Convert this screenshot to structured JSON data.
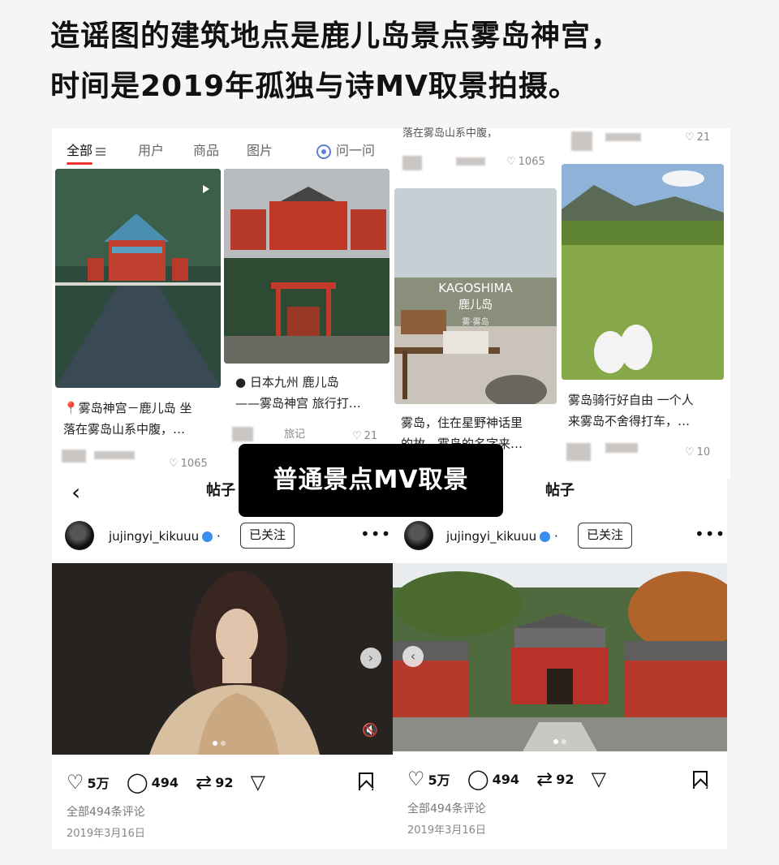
{
  "headline": {
    "line1": "造谣图的建筑地点是鹿儿岛景点雾岛神宫，",
    "line2": "时间是2019年孤独与诗MV取景拍摄。"
  },
  "search_tabs": [
    {
      "label": "全部",
      "active": true
    },
    {
      "label": "用户"
    },
    {
      "label": "商品"
    },
    {
      "label": "图片"
    },
    {
      "label": "问一问"
    }
  ],
  "cards": {
    "c1": {
      "title_line1": "📍雾岛神宫－鹿儿岛 坐",
      "title_line2": "落在雾岛山系中腹，…",
      "likes": "1065"
    },
    "c2": {
      "title_line1": "● 日本九州 鹿儿岛",
      "title_line2": "——雾岛神宫 旅行打…",
      "tag": "旅记",
      "likes": "21"
    },
    "c3": {
      "top_line": "落在雾岛山系中腹，",
      "likes_top": "1065",
      "img_text1": "KAGOSHIMA",
      "img_text2": "鹿儿岛",
      "img_text3": "雾·雾岛",
      "title_line1": "雾岛，住在星野神话里",
      "title_line2": "的故…雾岛的名字来…"
    },
    "c4": {
      "likes_top": "21",
      "title_line1": "雾岛骑行好自由 一个人",
      "title_line2": "来雾岛不舍得打车，…",
      "likes": "10"
    }
  },
  "overlay_label": "普通景点MV取景",
  "posts": [
    {
      "header": "帖子",
      "username": "jujingyi_kikuuu",
      "follow": "已关注",
      "more": "•••",
      "likes": "5万",
      "comments_count": "494",
      "reposts": "92",
      "all_comments": "全部494条评论",
      "date": "2019年3月16日"
    },
    {
      "header": "帖子",
      "username": "jujingyi_kikuuu",
      "follow": "已关注",
      "more": "•••",
      "likes": "5万",
      "comments_count": "494",
      "reposts": "92",
      "all_comments": "全部494条评论",
      "date": "2019年3月16日"
    }
  ],
  "icons": {
    "back": "‹",
    "heart": "♡",
    "comment": "◯",
    "repost": "⇄",
    "share": "▽",
    "next": "›",
    "prev": "‹",
    "mute": "🔇"
  }
}
